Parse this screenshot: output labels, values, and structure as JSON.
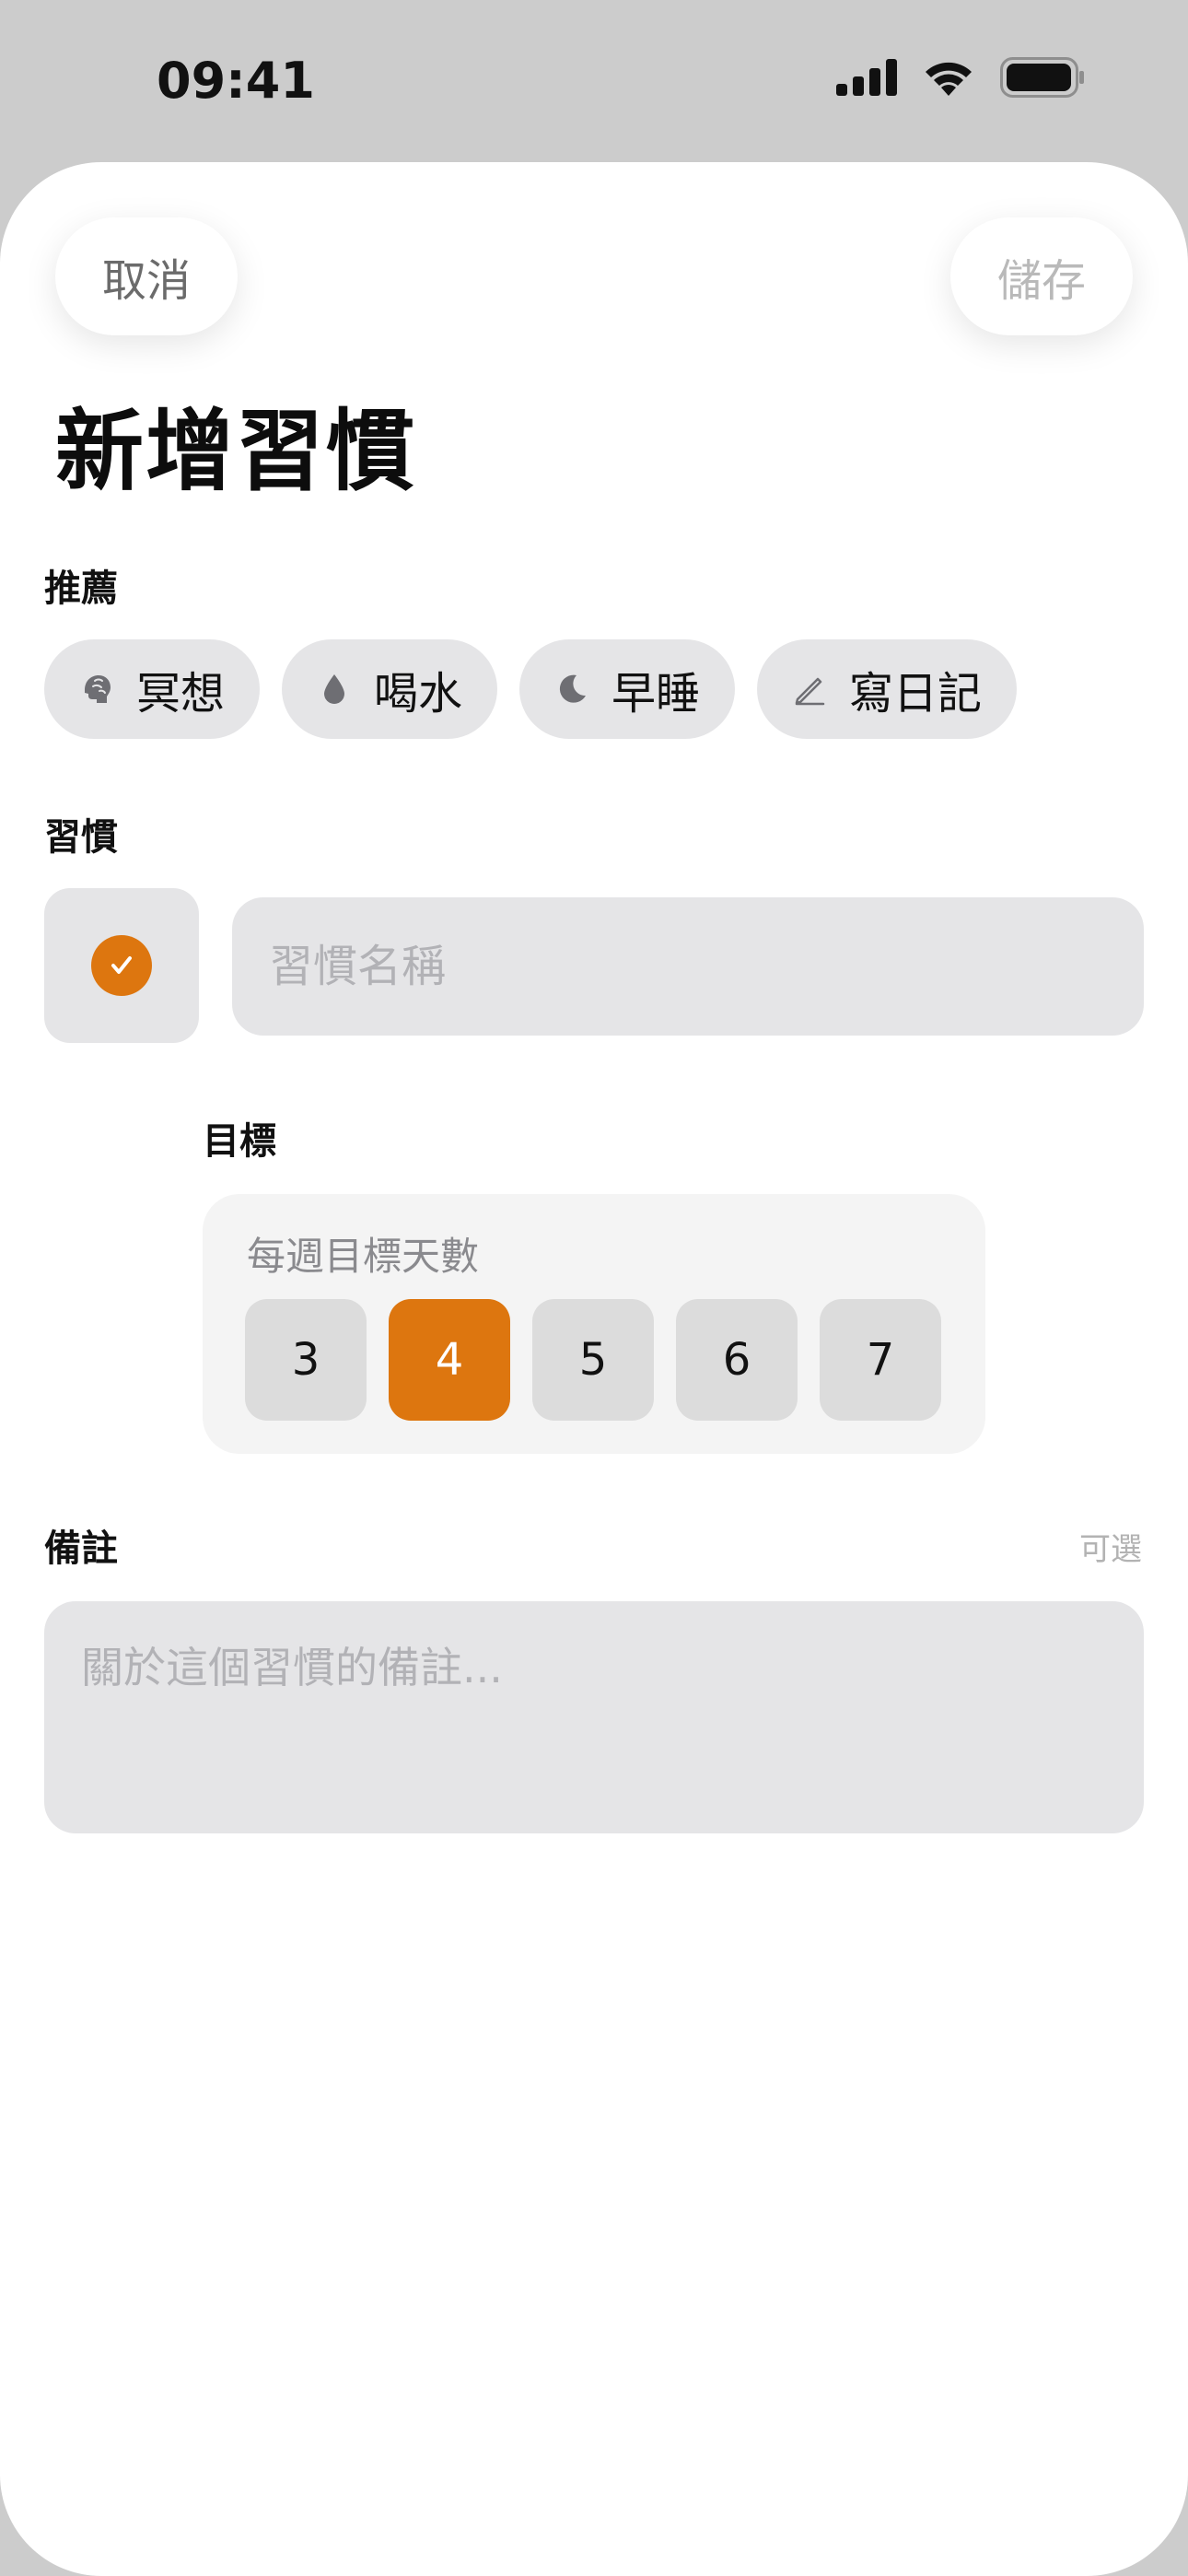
{
  "status_bar": {
    "time": "09:41",
    "icons": [
      "cellular-signal-icon",
      "wifi-icon",
      "battery-icon"
    ]
  },
  "nav": {
    "cancel_label": "取消",
    "save_label": "儲存"
  },
  "title": "新增習慣",
  "suggestions": {
    "label": "推薦",
    "items": [
      {
        "icon": "brain-icon",
        "label": "冥想"
      },
      {
        "icon": "water-drop-icon",
        "label": "喝水"
      },
      {
        "icon": "moon-icon",
        "label": "早睡"
      },
      {
        "icon": "pencil-icon",
        "label": "寫日記"
      }
    ]
  },
  "habit": {
    "label": "習慣",
    "icon": "checkmark-icon",
    "name_value": "",
    "name_placeholder": "習慣名稱"
  },
  "goal": {
    "label": "目標",
    "caption": "每週目標天數",
    "options": [
      "3",
      "4",
      "5",
      "6",
      "7"
    ],
    "selected": "4"
  },
  "notes": {
    "label": "備註",
    "optional": "可選",
    "value": "",
    "placeholder": "關於這個習慣的備註..."
  },
  "colors": {
    "accent": "#dd760f",
    "field_bg": "#e5e5e7",
    "outer_bg": "#cccccc"
  }
}
